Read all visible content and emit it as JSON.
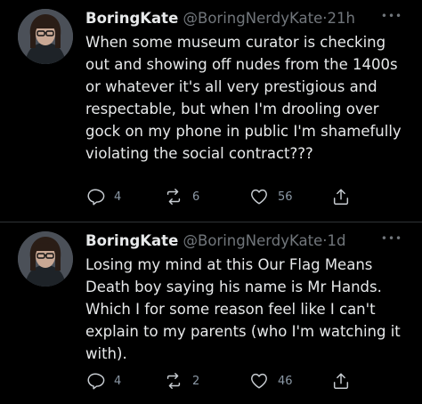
{
  "tweets": [
    {
      "display_name": "BoringKate",
      "handle": "@BoringNerdyKate",
      "separator": "·",
      "timestamp": "21h",
      "text": "When some museum curator is checking out and showing off nudes from the 1400s or whatever it's all very prestigious and respectable, but when I'm drooling over gock on my phone in public I'm shamefully violating the social contract???",
      "replies": "4",
      "retweets": "6",
      "likes": "56",
      "more_icon": "more-dots-icon"
    },
    {
      "display_name": "BoringKate",
      "handle": "@BoringNerdyKate",
      "separator": "·",
      "timestamp": "1d",
      "text": "Losing my mind at this Our Flag Means Death boy saying his name is Mr Hands. Which I for some reason feel like I can't explain to my parents (who I'm watching it with).",
      "replies": "4",
      "retweets": "2",
      "likes": "46",
      "more_icon": "more-dots-icon"
    }
  ],
  "icons": {
    "reply": "reply-icon",
    "retweet": "retweet-icon",
    "like": "heart-icon",
    "share": "share-icon"
  },
  "colors": {
    "background": "#000000",
    "text": "#e7e9ea",
    "muted": "#71767b",
    "divider": "#2f3336"
  }
}
